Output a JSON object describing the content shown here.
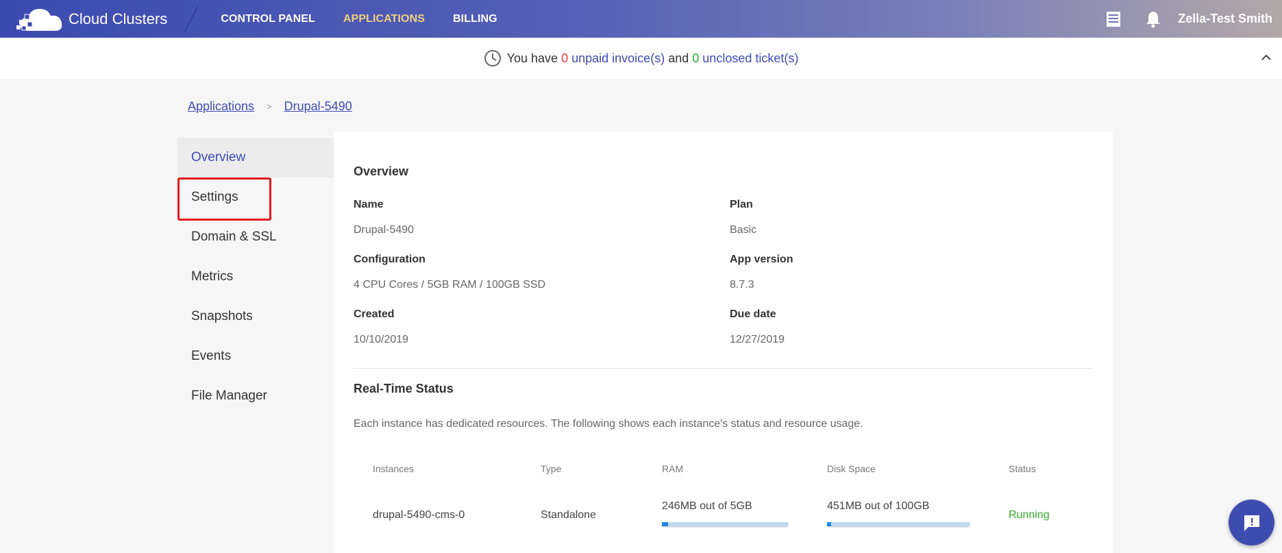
{
  "brand": {
    "name": "Cloud Clusters"
  },
  "nav": [
    {
      "label": "CONTROL PANEL",
      "active": false
    },
    {
      "label": "APPLICATIONS",
      "active": true
    },
    {
      "label": "BILLING",
      "active": false
    }
  ],
  "header": {
    "user_name": "Zella-Test Smith"
  },
  "notice": {
    "prefix": "You have",
    "invoice_count": "0",
    "invoice_link": "unpaid invoice(s)",
    "mid": "and",
    "ticket_count": "0",
    "ticket_link": "unclosed ticket(s)"
  },
  "breadcrumb": {
    "items": [
      "Applications",
      "Drupal-5490"
    ],
    "separator": ">"
  },
  "sidebar": {
    "items": [
      {
        "label": "Overview",
        "active": true
      },
      {
        "label": "Settings",
        "active": false
      },
      {
        "label": "Domain & SSL",
        "active": false
      },
      {
        "label": "Metrics",
        "active": false
      },
      {
        "label": "Snapshots",
        "active": false
      },
      {
        "label": "Events",
        "active": false
      },
      {
        "label": "File Manager",
        "active": false
      }
    ]
  },
  "overview": {
    "title": "Overview",
    "fields": {
      "name": {
        "label": "Name",
        "value": "Drupal-5490"
      },
      "plan": {
        "label": "Plan",
        "value": "Basic"
      },
      "configuration": {
        "label": "Configuration",
        "value": "4 CPU Cores / 5GB RAM / 100GB SSD"
      },
      "app_version": {
        "label": "App version",
        "value": "8.7.3"
      },
      "created": {
        "label": "Created",
        "value": "10/10/2019"
      },
      "due_date": {
        "label": "Due date",
        "value": "12/27/2019"
      }
    }
  },
  "realtime": {
    "title": "Real-Time Status",
    "description": "Each instance has dedicated resources. The following shows each instance's status and resource usage.",
    "columns": [
      "Instances",
      "Type",
      "RAM",
      "Disk Space",
      "Status"
    ],
    "rows": [
      {
        "instance": "drupal-5490-cms-0",
        "type": "Standalone",
        "ram": "246MB out of 5GB",
        "ram_fraction": 0.048,
        "disk": "451MB out of 100GB",
        "disk_fraction": 0.0045,
        "status": "Running"
      }
    ]
  },
  "colors": {
    "accent": "#3d4db7",
    "active_nav": "#f0d080",
    "running": "#2eae2e",
    "unpaid": "#e53935"
  }
}
